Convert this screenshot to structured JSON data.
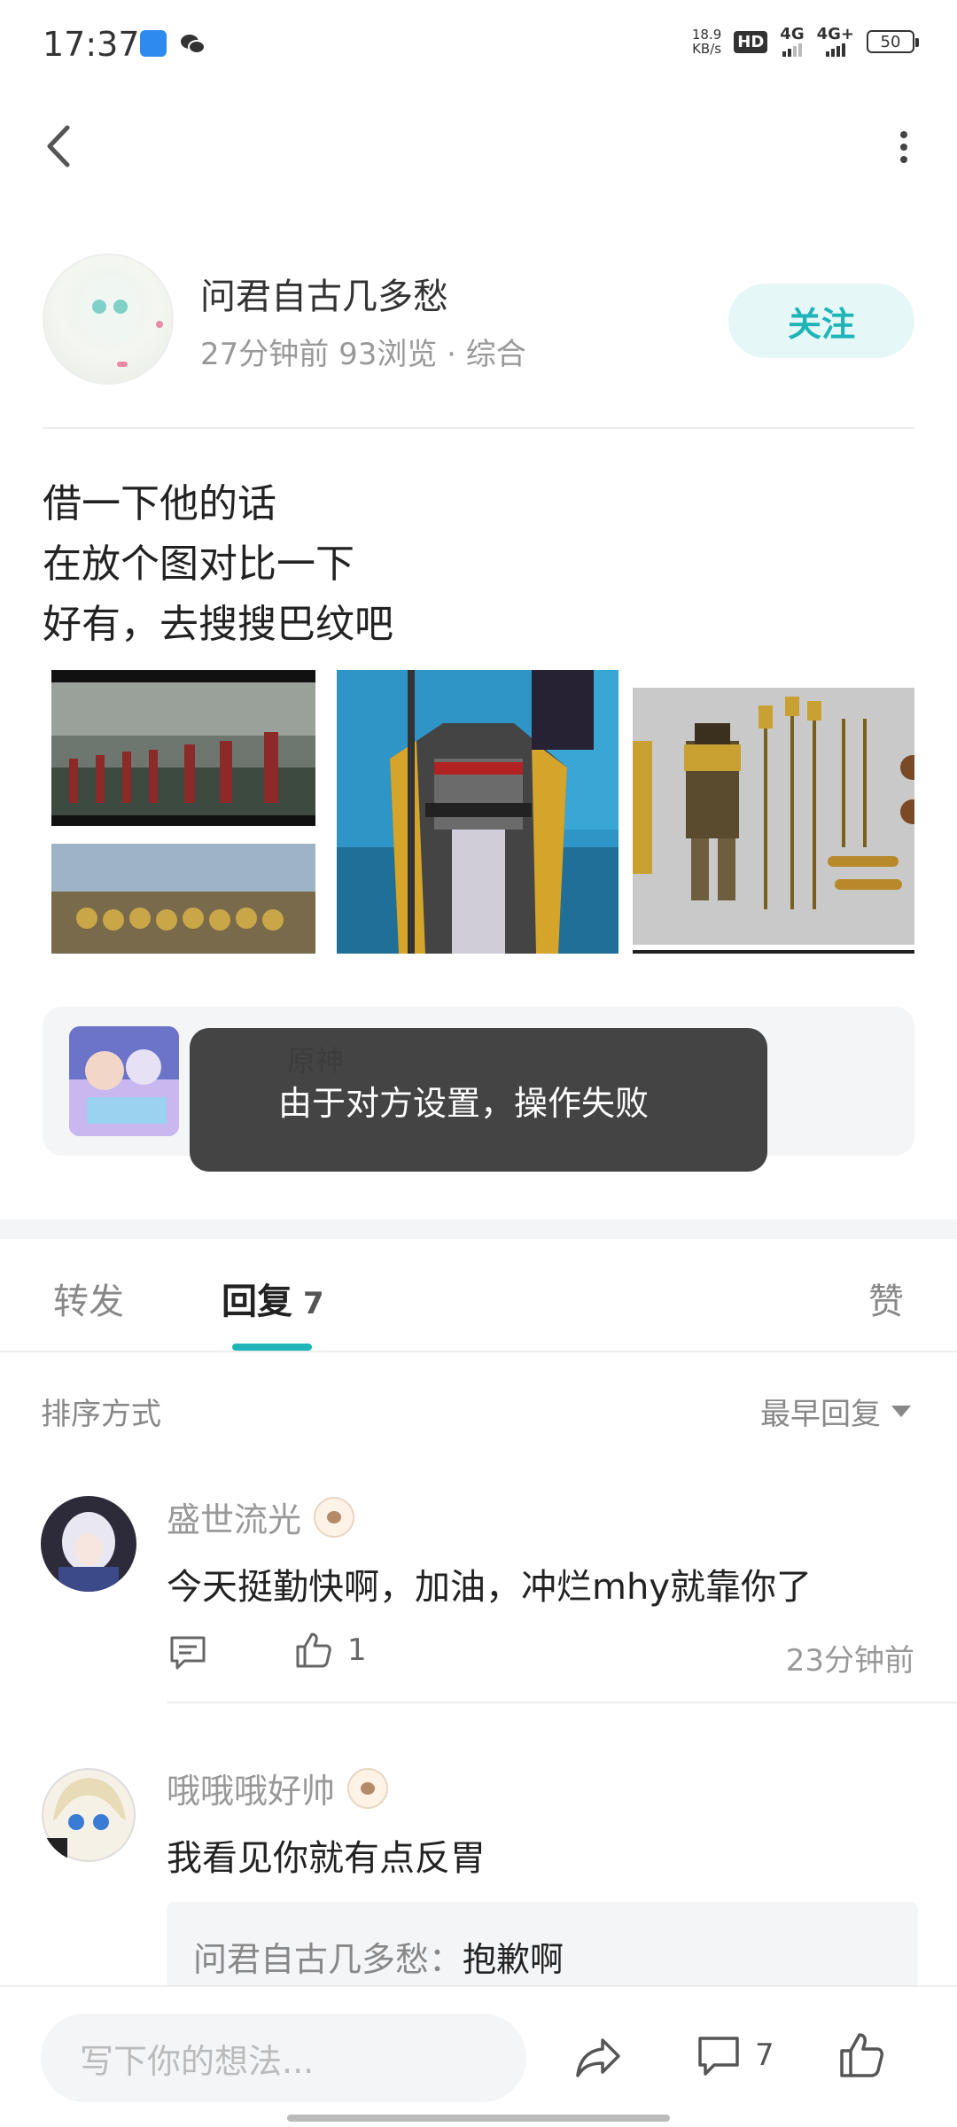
{
  "status_bar": {
    "time": "17:37",
    "net_speed_value": "18.9",
    "net_speed_unit": "KB/s",
    "hd": "HD",
    "hd_sub": "1 2",
    "signal1": "4G",
    "signal2": "4G+",
    "battery": "50"
  },
  "author": {
    "name": "问君自古几多愁",
    "meta": "27分钟前  93浏览  ·  综合",
    "follow_label": "关注"
  },
  "post": {
    "lines": [
      "借一下他的话",
      "在放个图对比一下",
      "好有，去搜搜巴纹吧"
    ]
  },
  "topic": {
    "name": "原神"
  },
  "toast": {
    "message": "由于对方设置，操作失败"
  },
  "tabs": {
    "repost": "转发",
    "reply": "回复",
    "reply_count": "7",
    "like": "赞"
  },
  "sort": {
    "label": "排序方式",
    "selected": "最早回复"
  },
  "comments": [
    {
      "name": "盛世流光",
      "text": "今天挺勤快啊，加油，冲烂mhy就靠你了",
      "likes": "1",
      "time": "23分钟前"
    },
    {
      "name": "哦哦哦好帅",
      "text": "我看见你就有点反胃",
      "reply_author": "问君自古几多愁：",
      "reply_text": "抱歉啊"
    }
  ],
  "bottom_bar": {
    "input_placeholder": "写下你的想法...",
    "comment_count": "7"
  },
  "colors": {
    "accent": "#1fb5b8",
    "toast_bg": "#3c3c3c",
    "muted_text": "#999999"
  }
}
